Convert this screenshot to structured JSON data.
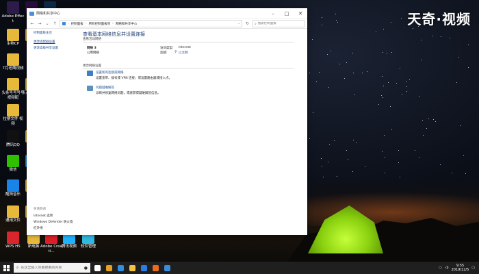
{
  "watermark": "天奇·视频",
  "desktop_icons": [
    {
      "label": "Adobe Effect",
      "color": "#2d1c4a"
    },
    {
      "label": "",
      "color": "#2b0d3d"
    },
    {
      "label": "",
      "color": "#0c2b47"
    },
    {
      "label": "生物CP",
      "color": "#e7b93a"
    },
    {
      "label": "快坑",
      "color": "#e7b93a"
    },
    {
      "label": "7月老鹰视频",
      "color": "#e7b93a"
    },
    {
      "label": "头条号号号号 视频配",
      "color": "#e7b93a"
    },
    {
      "label": "天奇号视频",
      "color": "#e7b93a"
    },
    {
      "label": "拉票文件 视频",
      "color": "#e7b93a"
    },
    {
      "label": "腾讯QQ",
      "color": "#111111"
    },
    {
      "label": "腾讯",
      "color": "#e7b93a"
    },
    {
      "label": "微信",
      "color": "#2dc100"
    },
    {
      "label": "360",
      "color": "#1b8ddc"
    },
    {
      "label": "酷狗音乐",
      "color": "#1a83e8"
    },
    {
      "label": "小米",
      "color": "#e7b93a"
    },
    {
      "label": "通用文件",
      "color": "#e7b93a"
    },
    {
      "label": "快视",
      "color": "#e7b93a"
    },
    {
      "label": "WPS H5",
      "color": "#d8262c"
    },
    {
      "label": "新电脑",
      "color": "#e7b93a"
    },
    {
      "label": "Adobe Creati...",
      "color": "#da1f26"
    },
    {
      "label": "腾讯视频",
      "color": "#1fb2ff"
    },
    {
      "label": "软件管理",
      "color": "#2fb8e0"
    }
  ],
  "window": {
    "title": "网络和共享中心",
    "breadcrumb": [
      "控制面板",
      "所有控制面板项",
      "网络和共享中心"
    ],
    "search_placeholder": "搜索控制面板",
    "left_links": [
      "控制面板主页",
      "更改适配器设置",
      "更改高级共享设置"
    ],
    "see_also_label": "另请参阅",
    "see_also_links": [
      "Internet 选项",
      "Windows Defender 防火墙",
      "红外线"
    ],
    "heading": "查看基本网络信息并设置连接",
    "active_networks_label": "查看活动网络",
    "network_name": "网络 3",
    "network_type": "公用网络",
    "access_type_label": "访问类型:",
    "access_type_value": "Internet",
    "connections_label": "连接:",
    "connections_value": "以太网",
    "change_settings_label": "更改网络设置",
    "task1_title": "设置新的连接或网络",
    "task1_desc": "设置宽带、拨号或 VPN 连接；或设置路由器或接入点。",
    "task2_title": "问题疑难解答",
    "task2_desc": "诊断并修复网络问题，或者获得疑难解答信息。"
  },
  "taskbar": {
    "search_placeholder": "在这里输入你要搜索的内容",
    "apps": [
      {
        "name": "task-view",
        "color": "#ffffff"
      },
      {
        "name": "chrome",
        "color": "#e4a11b"
      },
      {
        "name": "edge",
        "color": "#2f8fe0"
      },
      {
        "name": "explorer",
        "color": "#f0c340"
      },
      {
        "name": "qq-browser",
        "color": "#2a7de1"
      },
      {
        "name": "media",
        "color": "#e86c1d"
      },
      {
        "name": "control-panel",
        "color": "#3c8ad8"
      }
    ],
    "time": "9:55",
    "date": "2019/12/5"
  }
}
